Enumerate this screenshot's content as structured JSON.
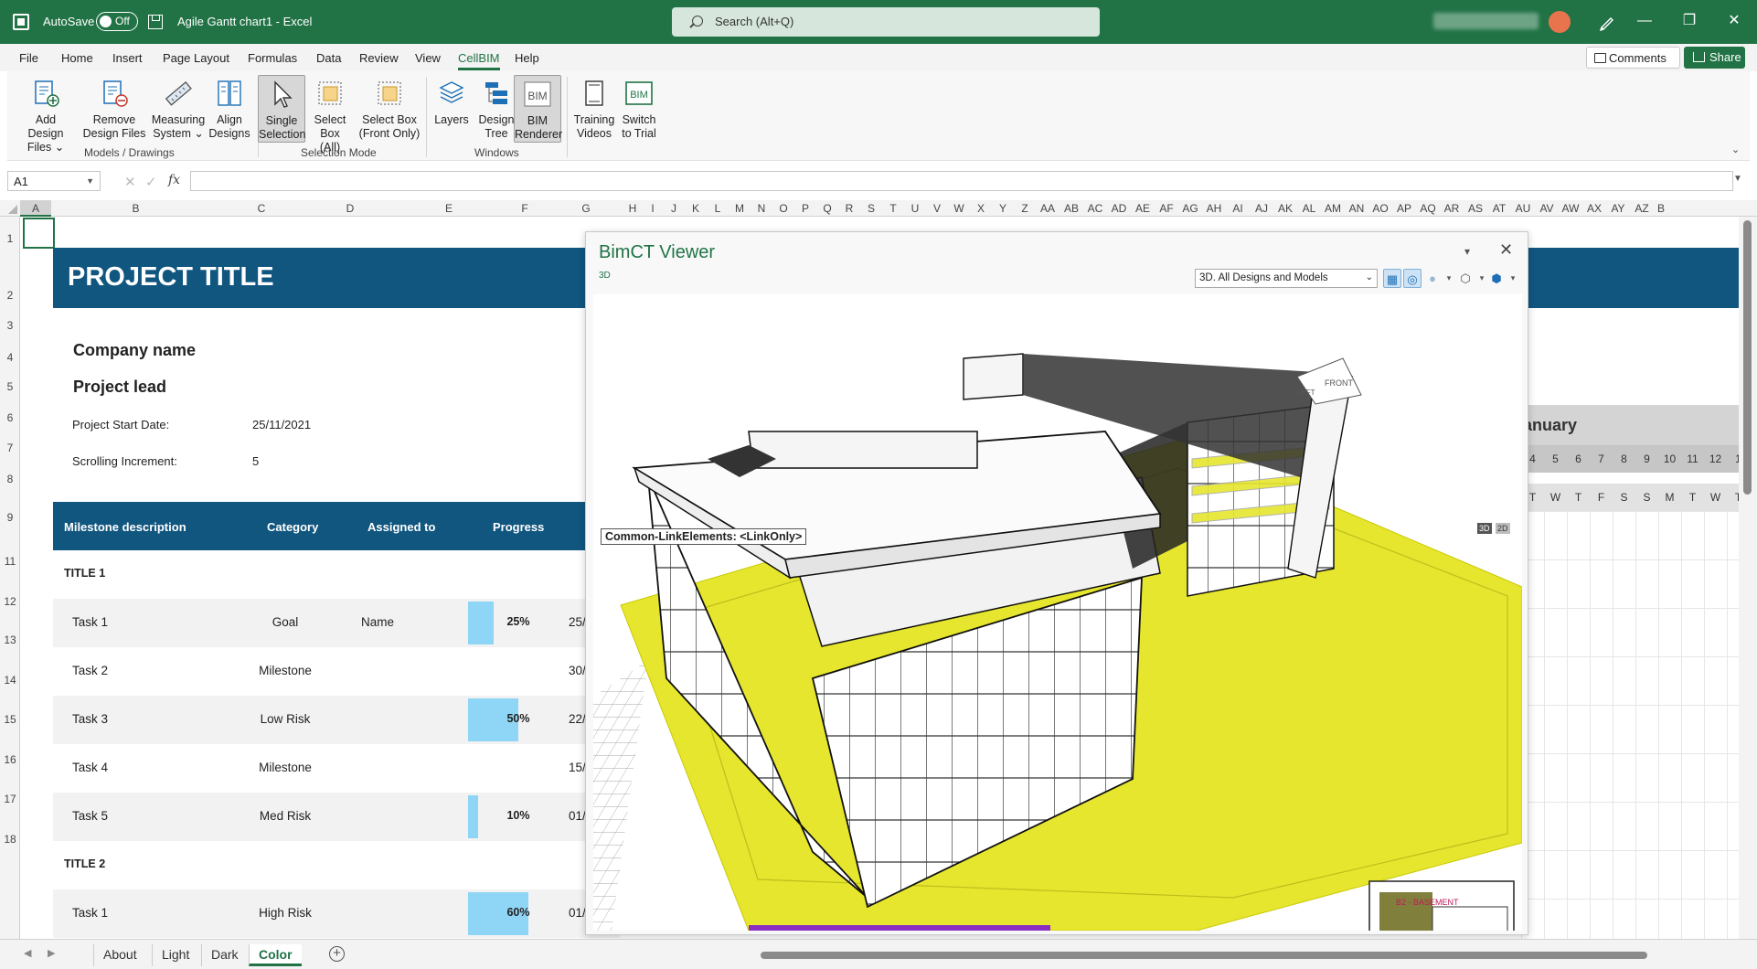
{
  "window": {
    "autosave_label": "AutoSave",
    "autosave_state": "Off",
    "doc_title": "Agile Gantt chart1  -  Excel",
    "search_placeholder": "Search (Alt+Q)",
    "minimize": "—",
    "restore": "❐",
    "close": "✕"
  },
  "menu": [
    "File",
    "Home",
    "Insert",
    "Page Layout",
    "Formulas",
    "Data",
    "Review",
    "View",
    "CellBIM",
    "Help"
  ],
  "menu_active": "CellBIM",
  "actions": {
    "comments": "Comments",
    "share": "Share"
  },
  "ribbon": {
    "buttons": [
      {
        "l1": "Add Design",
        "l2": "Files ⌄"
      },
      {
        "l1": "Remove",
        "l2": "Design Files"
      },
      {
        "l1": "Measuring",
        "l2": "System ⌄"
      },
      {
        "l1": "Align",
        "l2": "Designs"
      },
      {
        "l1": "Single",
        "l2": "Selection"
      },
      {
        "l1": "Select",
        "l2": "Box (All)"
      },
      {
        "l1": "Select Box",
        "l2": "(Front Only)"
      },
      {
        "l1": "Layers",
        "l2": ""
      },
      {
        "l1": "Design",
        "l2": "Tree"
      },
      {
        "l1": "BIM",
        "l2": "Renderer"
      },
      {
        "l1": "Training",
        "l2": "Videos"
      },
      {
        "l1": "Switch",
        "l2": "to Trial"
      }
    ],
    "groups": [
      "Models / Drawings",
      "Selection Mode",
      "Windows"
    ],
    "bim_icon_text": "BIM"
  },
  "formula": {
    "name_box": "A1",
    "fx": "fx",
    "cancel": "✕",
    "enter": "✓",
    "value": ""
  },
  "columns": [
    "A",
    "B",
    "C",
    "D",
    "E",
    "F",
    "G",
    "H",
    "I",
    "J",
    "K",
    "L",
    "M",
    "N",
    "O",
    "P",
    "Q",
    "R",
    "S",
    "T",
    "U",
    "V",
    "W",
    "X",
    "Y",
    "Z",
    "AA",
    "AB",
    "AC",
    "AD",
    "AE",
    "AF",
    "AG",
    "AH",
    "AI",
    "AJ",
    "AK",
    "AL",
    "AM",
    "AN",
    "AO",
    "AP",
    "AQ",
    "AR",
    "AS",
    "AT",
    "AU",
    "AV",
    "AW",
    "AX",
    "AY",
    "AZ",
    "B"
  ],
  "rows": [
    "1",
    "2",
    "3",
    "4",
    "5",
    "6",
    "7",
    "8",
    "9",
    "11",
    "12",
    "13",
    "14",
    "15",
    "16",
    "17",
    "18"
  ],
  "sheet": {
    "project_title": "PROJECT TITLE",
    "company": "Company name",
    "lead": "Project lead",
    "start_label": "Project Start Date:",
    "start_value": "25/11/2021",
    "increment_label": "Scrolling Increment:",
    "increment_value": "5",
    "headers": [
      "Milestone description",
      "Category",
      "Assigned to",
      "Progress"
    ],
    "rows": [
      {
        "desc": "TITLE 1",
        "title": true
      },
      {
        "desc": "Task 1",
        "cat": "Goal",
        "assigned": "Name",
        "progress": "25%",
        "pct": 0.25,
        "date": "25/"
      },
      {
        "desc": "Task 2",
        "cat": "Milestone",
        "date": "30/"
      },
      {
        "desc": "Task 3",
        "cat": "Low Risk",
        "progress": "50%",
        "pct": 0.5,
        "date": "22/"
      },
      {
        "desc": "Task 4",
        "cat": "Milestone",
        "date": "15/"
      },
      {
        "desc": "Task 5",
        "cat": "Med Risk",
        "progress": "10%",
        "pct": 0.1,
        "date": "01/"
      },
      {
        "desc": "TITLE 2",
        "title": true
      },
      {
        "desc": "Task 1",
        "cat": "High Risk",
        "progress": "60%",
        "pct": 0.6,
        "date": "01/"
      }
    ],
    "calendar_month": "anuary",
    "calendar_days": [
      "4",
      "5",
      "6",
      "7",
      "8",
      "9",
      "10",
      "11",
      "12",
      "1"
    ],
    "calendar_weekdays": [
      "T",
      "W",
      "T",
      "F",
      "S",
      "S",
      "M",
      "T",
      "W",
      "T"
    ]
  },
  "sheet_tabs": [
    "About",
    "Light",
    "Dark",
    "Color"
  ],
  "active_tab": "Color",
  "viewer": {
    "title": "BimCT Viewer",
    "subtitle": "3D",
    "view_select": "3D. All Designs and Models",
    "link_label": "Common-LinkElements: <LinkOnly>",
    "mode_3d": "3D",
    "mode_2d": "2D",
    "cube_left": "LEFT",
    "cube_front": "FRONT",
    "minimap_label": "B2 - BASEMENT",
    "menu_glyph": "▾",
    "close_glyph": "✕"
  },
  "colors": {
    "excel_green": "#217346",
    "banner_blue": "#11567f",
    "progress": "#8fd6f6",
    "slab_yellow": "#e6e62e"
  }
}
